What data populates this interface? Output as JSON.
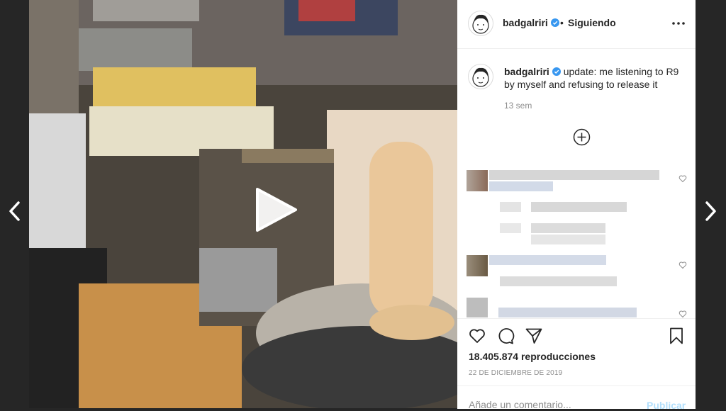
{
  "header": {
    "username": "badgalriri",
    "separator": "•",
    "follow_label": "Siguiendo",
    "more_icon": "more-horizontal-icon"
  },
  "caption": {
    "username": "badgalriri",
    "text": "update: me listening to R9 by myself and refusing to release it",
    "time": "13 sem"
  },
  "actions": {
    "like_icon": "heart-icon",
    "comment_icon": "comment-icon",
    "share_icon": "share-icon",
    "save_icon": "bookmark-icon"
  },
  "stats": {
    "views": "18.405.874 reproducciones",
    "date": "22 DE DICIEMBRE DE 2019"
  },
  "comment_box": {
    "placeholder": "Añade un comentario...",
    "publish_label": "Publicar"
  },
  "colors": {
    "background": "#262626",
    "text": "#262626",
    "muted": "#8e8e8e",
    "verified": "#3897f0",
    "publish_disabled": "#b2dffc"
  }
}
